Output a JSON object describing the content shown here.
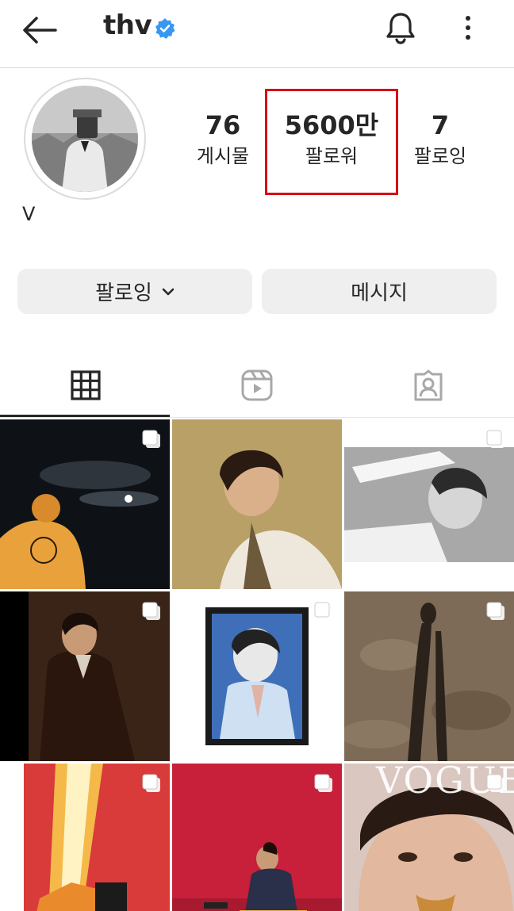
{
  "header": {
    "username": "thv",
    "verified_color": "#3897f0"
  },
  "profile": {
    "display_name": "V",
    "stats": [
      {
        "value": "76",
        "label": "게시물"
      },
      {
        "value": "5600만",
        "label": "팔로워"
      },
      {
        "value": "7",
        "label": "팔로잉"
      }
    ],
    "highlight_color": "#d50f17"
  },
  "buttons": {
    "following_label": "팔로잉",
    "message_label": "메시지"
  },
  "tabs": [
    "grid-icon",
    "reels-icon",
    "tagged-icon"
  ],
  "icons": {
    "back": "arrow-left-icon",
    "bell": "bell-icon",
    "more": "more-vertical-icon"
  },
  "grid": {
    "posts": [
      {
        "name": "post-night-sky",
        "multi": true
      },
      {
        "name": "post-portrait-scarf",
        "multi": false
      },
      {
        "name": "post-bw-hat",
        "multi": true
      },
      {
        "name": "post-brown-suit",
        "multi": true
      },
      {
        "name": "post-painting",
        "multi": true
      },
      {
        "name": "post-shadow-sand",
        "multi": true
      },
      {
        "name": "post-red-light",
        "multi": true
      },
      {
        "name": "post-red-chair",
        "multi": true
      },
      {
        "name": "post-vogue",
        "multi": true,
        "overlay_text": "VOGUE"
      }
    ]
  }
}
